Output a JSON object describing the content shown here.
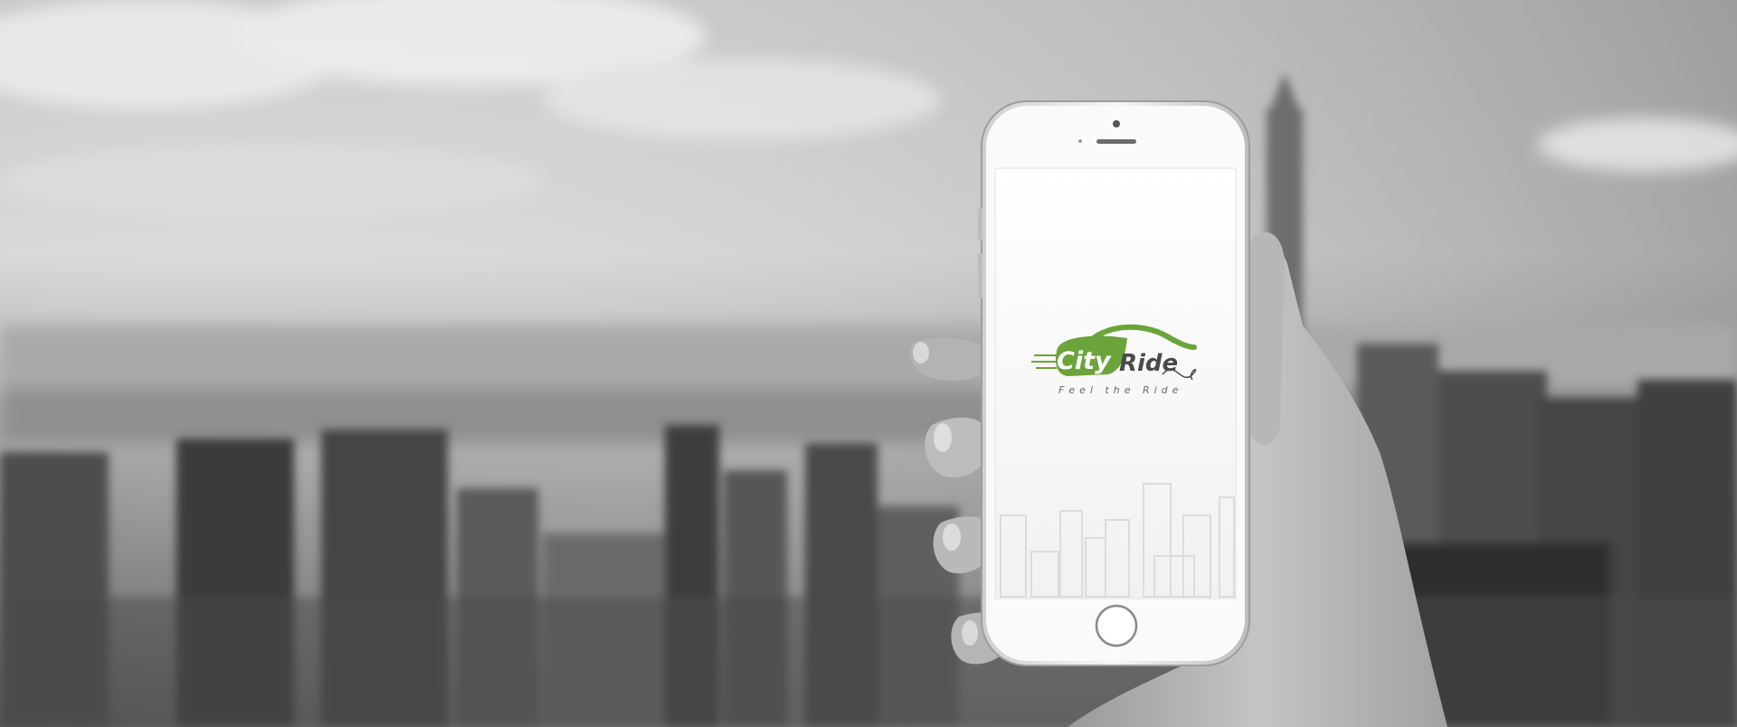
{
  "app": {
    "brand_word_1": "City",
    "brand_word_2": "Ride",
    "tagline": "Feel the Ride"
  },
  "colors": {
    "brand_green": "#6aa43a",
    "brand_dark": "#4a4a4a",
    "screen_bg": "#ffffff",
    "phone_body": "#e9e9e9"
  },
  "icons": {
    "logo": "car-logo-icon",
    "home_button": "home-button-icon",
    "camera": "front-camera-icon",
    "speaker": "earpiece-speaker-icon"
  }
}
